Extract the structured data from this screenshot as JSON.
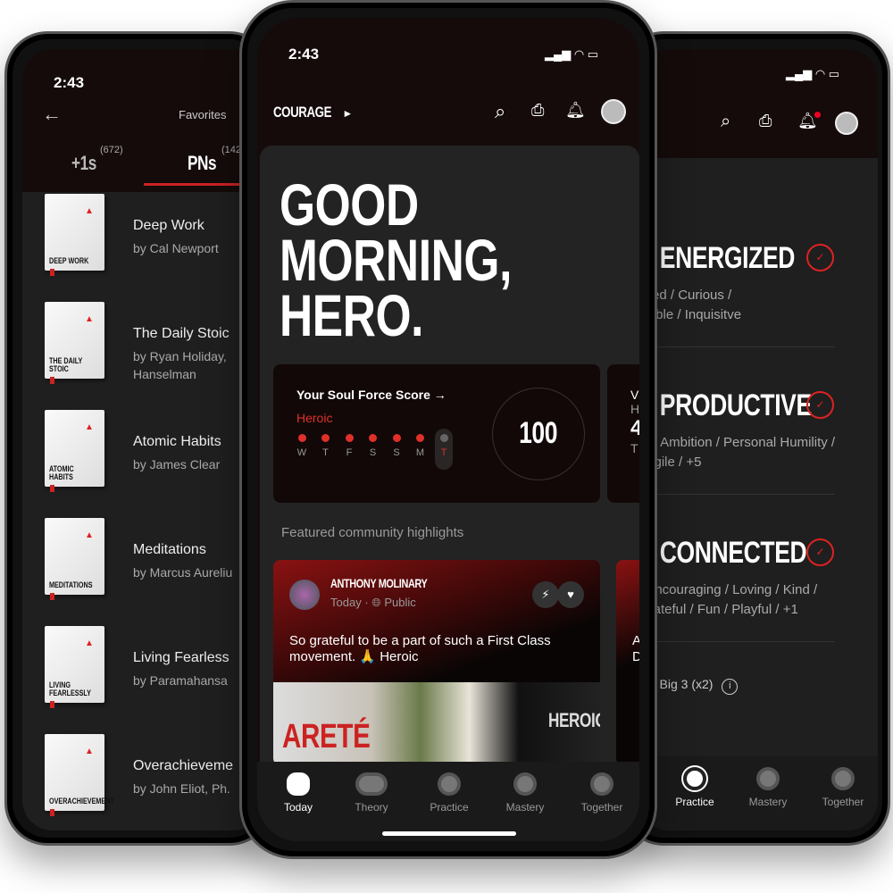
{
  "left_phone": {
    "time": "2:43",
    "title": "Favorites",
    "tabs": [
      {
        "label": "+1s",
        "count": "(672)"
      },
      {
        "label": "PNs",
        "count": "(142"
      }
    ],
    "books": [
      {
        "cover": "DEEP WORK",
        "title": "Deep Work",
        "author": "by Cal Newport"
      },
      {
        "cover": "THE DAILY STOIC",
        "title": "The Daily Stoic",
        "author": "by Ryan Holiday,",
        "author2": "Hanselman"
      },
      {
        "cover": "ATOMIC HABITS",
        "title": "Atomic Habits",
        "author": "by James Clear"
      },
      {
        "cover": "MEDITATIONS",
        "title": "Meditations",
        "author": "by Marcus Aureliu"
      },
      {
        "cover": "LIVING FEARLESSLY",
        "title": "Living Fearless",
        "author": "by Paramahansa"
      },
      {
        "cover": "OVERACHIEVEMENT",
        "title": "Overachieveme",
        "author": "by John Eliot, Ph."
      }
    ]
  },
  "center_phone": {
    "time": "2:43",
    "brand": "COURAGE",
    "greeting": [
      "GOOD",
      "MORNING,",
      "HERO."
    ],
    "score_card": {
      "title": "Your Soul Force Score",
      "arrow": "→",
      "level": "Heroic",
      "score": "100",
      "days": [
        "W",
        "T",
        "F",
        "S",
        "S",
        "M",
        "T"
      ],
      "completed": [
        true,
        true,
        true,
        true,
        true,
        true,
        false
      ]
    },
    "next_card_partial": {
      "l1": "V",
      "l2": "H",
      "l3": "4",
      "l4": "T"
    },
    "featured_label": "Featured community highlights",
    "post": {
      "author": "ANTHONY MOLINARY",
      "date": "Today",
      "dot": "·",
      "visibility": "Public",
      "text": "So grateful to be a part of such a First Class movement. 🙏 Heroic",
      "image_text": [
        "ARETÉ",
        "HEROIC"
      ]
    },
    "next_post_partial": {
      "l1": "A",
      "l2": "D"
    },
    "tabs": [
      "Today",
      "Theory",
      "Practice",
      "Mastery",
      "Together"
    ],
    "active_tab": "Today"
  },
  "right_phone": {
    "items": [
      {
        "title": "Y ENERGIZED",
        "desc": [
          "lined / Curious /",
          "exible / Inquisitve"
        ]
      },
      {
        "title": "Y PRODUCTIVE",
        "desc": [
          "rce Ambition / Personal Humility /",
          "fragile / +5"
        ]
      },
      {
        "title": "Y CONNECTED",
        "desc": [
          "/ Encouraging / Loving / Kind /",
          "Grateful / Fun / Playful / +1"
        ]
      }
    ],
    "footer": "r Big 3 (x2)",
    "tabs": [
      "Practice",
      "Mastery",
      "Together"
    ],
    "active_tab": "Practice"
  },
  "colors": {
    "accent": "#e0302a",
    "background": "#1f1f1f",
    "header": "#150b0b"
  }
}
